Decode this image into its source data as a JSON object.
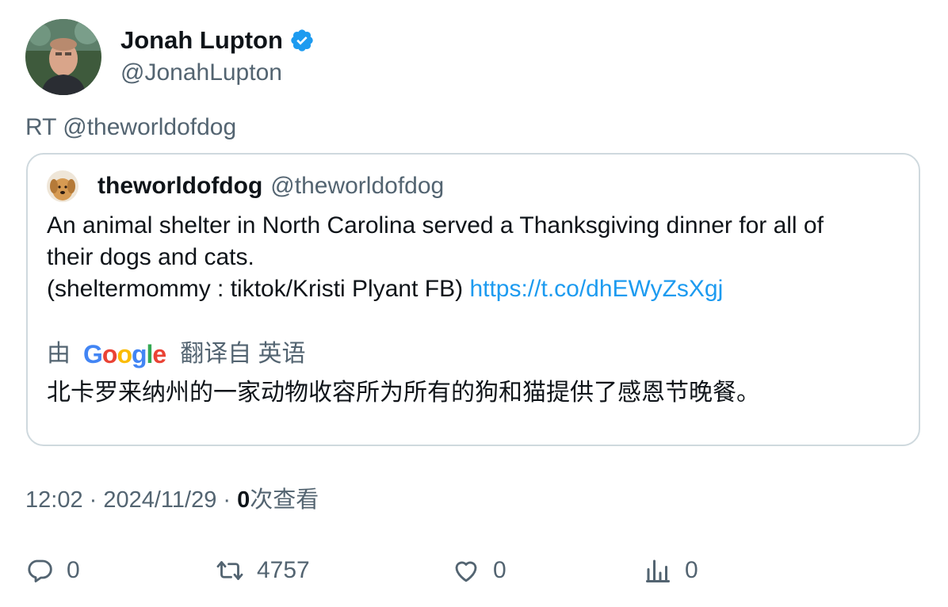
{
  "author": {
    "display_name": "Jonah Lupton",
    "handle": "@JonahLupton",
    "verified_icon": "verified-badge-icon",
    "avatar_icon": "avatar-photo"
  },
  "retweet_line": "RT @theworldofdog",
  "quoted": {
    "name": "theworldofdog",
    "handle": "@theworldofdog",
    "avatar_icon": "dog-avatar-photo",
    "text_line1": "An animal shelter in North Carolina served a Thanksgiving dinner for all of",
    "text_line2": "their dogs and cats.",
    "text_line3": "(sheltermommy : tiktok/Kristi Plyant FB) ",
    "link": "https://t.co/dhEWyZsXgj",
    "translation": {
      "prefix": "由",
      "provider": "Google",
      "suffix": "翻译自 英语",
      "text": "北卡罗来纳州的一家动物收容所为所有的狗和猫提供了感恩节晚餐。"
    }
  },
  "meta": {
    "time_date": "12:02 · 2024/11/29 · ",
    "views_count": "0",
    "views_label": "次查看"
  },
  "actions": {
    "replies": "0",
    "retweets": "4757",
    "likes": "0",
    "views": "0"
  },
  "colors": {
    "text_primary": "#0f1419",
    "text_secondary": "#536471",
    "link": "#1d9bf0",
    "border": "#cfd9de",
    "verified": "#1d9bf0"
  }
}
